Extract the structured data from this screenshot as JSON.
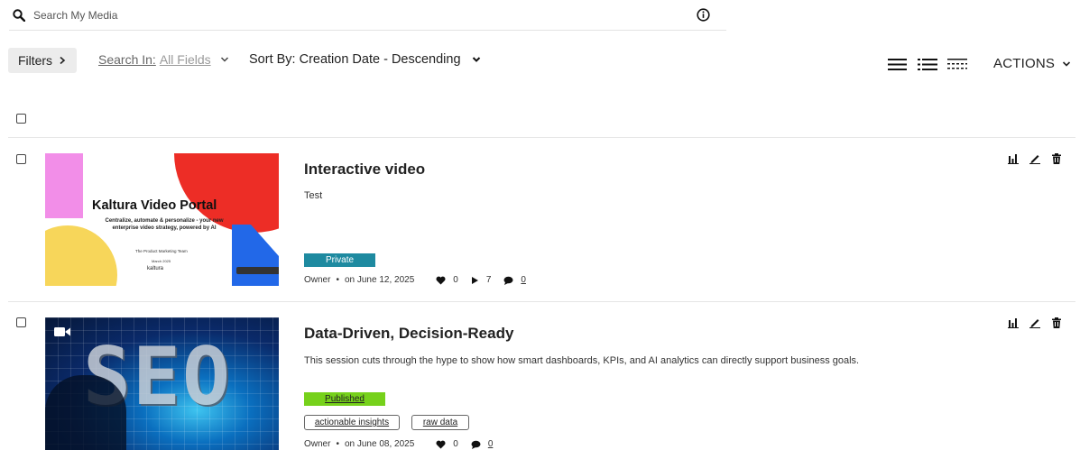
{
  "search": {
    "placeholder": "Search My Media"
  },
  "toolbar": {
    "filters_label": "Filters",
    "search_in_prefix": "Search In:",
    "search_in_value": "All Fields",
    "sort_label": "Sort By: Creation Date - Descending",
    "actions_label": "ACTIONS"
  },
  "entries": [
    {
      "title": "Interactive video",
      "description": "Test",
      "status": "Private",
      "owner": "Owner",
      "date": "on June 12, 2025",
      "likes": "0",
      "plays": "7",
      "comments": "0",
      "thumbnail": {
        "brand": "Kaltura Video Portal",
        "subtitle": "Centralize, automate & personalize - your new enterprise video strategy, powered by AI",
        "team": "The Product Marketing Team",
        "date": "March 2025",
        "logo": "kaltura"
      }
    },
    {
      "title": "Data-Driven, Decision-Ready",
      "description": "This session cuts through the hype to show how smart dashboards, KPIs, and AI analytics can directly support business goals.",
      "status": "Published",
      "tags": [
        "actionable insights",
        "raw data"
      ],
      "owner": "Owner",
      "date": "on June 08, 2025",
      "likes": "0",
      "comments": "0",
      "thumbnail": {
        "art_text": "SEO"
      }
    }
  ],
  "colors": {
    "private": "#1e8aa0",
    "published": "#76d11b"
  }
}
